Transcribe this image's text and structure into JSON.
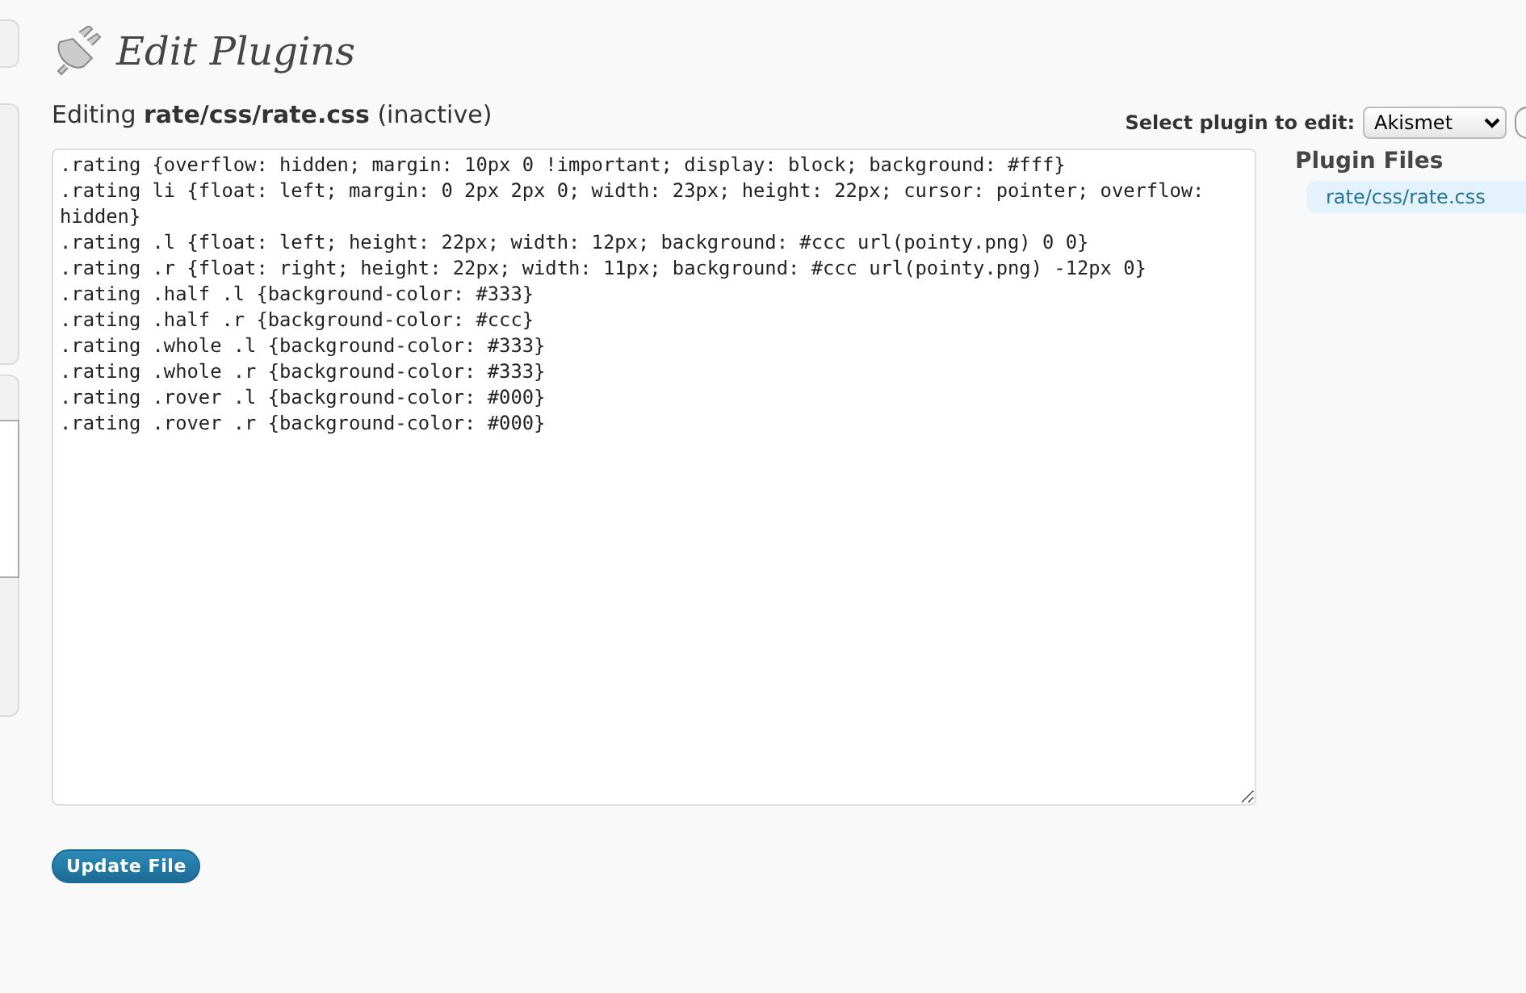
{
  "page": {
    "title": "Edit Plugins"
  },
  "editing": {
    "prefix": "Editing",
    "file": "rate/css/rate.css",
    "status": "(inactive)"
  },
  "plugin_select": {
    "label": "Select plugin to edit:",
    "value": "Akismet"
  },
  "editor": {
    "lines": [
      ".rating {overflow: hidden; margin: 10px 0 !important; display: block; background: #fff}",
      ".rating li {float: left; margin: 0 2px 2px 0; width: 23px; height: 22px; cursor: pointer; overflow: hidden}",
      ".rating .l {float: left; height: 22px; width: 12px; background: #ccc url(pointy.png) 0 0}",
      ".rating .r {float: right; height: 22px; width: 11px; background: #ccc url(pointy.png) -12px 0}",
      ".rating .half .l {background-color: #333}",
      ".rating .half .r {background-color: #ccc}",
      ".rating .whole .l {background-color: #333}",
      ".rating .whole .r {background-color: #333}",
      ".rating .rover .l {background-color: #000}",
      ".rating .rover .r {background-color: #000}"
    ]
  },
  "plugin_files": {
    "heading": "Plugin Files",
    "items": [
      {
        "label": "rate/css/rate.css",
        "selected": true
      }
    ]
  },
  "buttons": [
    {
      "label": "Update File"
    }
  ]
}
